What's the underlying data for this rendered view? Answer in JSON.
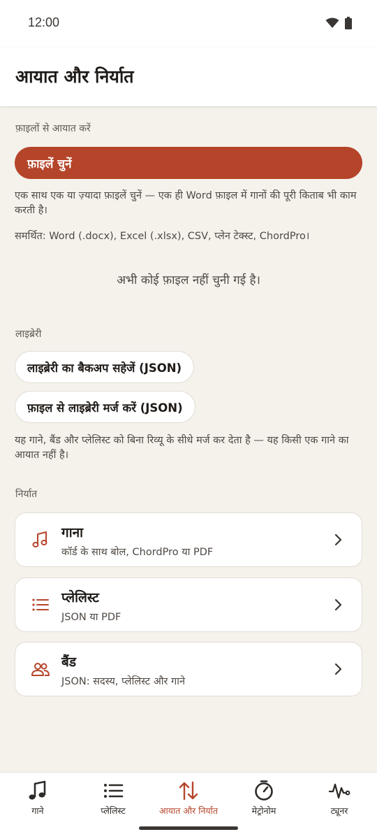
{
  "status_bar": {
    "time": "12:00"
  },
  "header": {
    "title": "आयात और निर्यात"
  },
  "import": {
    "section_label": "फ़ाइलों से आयात करें",
    "choose_files_label": "फ़ाइलें चुनें",
    "help_text": "एक साथ एक या ज़्यादा फ़ाइलें चुनें — एक ही Word फ़ाइल में गानों की पूरी किताब भी काम करती है।",
    "supported_text": "समर्थित: Word (.docx), Excel (.xlsx), CSV, प्लेन टेक्स्ट, ChordPro।",
    "empty_state": "अभी कोई फ़ाइल नहीं चुनी गई है।"
  },
  "library": {
    "section_label": "लाइब्रेरी",
    "backup_label": "लाइब्रेरी का बैकअप सहेजें (JSON)",
    "merge_label": "फ़ाइल से लाइब्रेरी मर्ज करें (JSON)",
    "help_text": "यह गाने, बैंड और प्लेलिस्ट को बिना रिव्यू के सीधे मर्ज कर देता है — यह किसी एक गाने का आयात नहीं है।"
  },
  "export": {
    "section_label": "निर्यात",
    "items": [
      {
        "title": "गाना",
        "subtitle": "कॉर्ड के साथ बोल, ChordPro या PDF",
        "icon": "music-note-icon"
      },
      {
        "title": "प्लेलिस्ट",
        "subtitle": "JSON या PDF",
        "icon": "list-icon"
      },
      {
        "title": "बैंड",
        "subtitle": "JSON: सदस्य, प्लेलिस्ट और गाने",
        "icon": "people-icon"
      }
    ]
  },
  "bottom_nav": {
    "items": [
      {
        "label": "गाने",
        "icon": "music-note-icon"
      },
      {
        "label": "प्लेलिस्ट",
        "icon": "list-icon"
      },
      {
        "label": "आयात और निर्यात",
        "icon": "import-export-icon",
        "active": true
      },
      {
        "label": "मेट्रोनोम",
        "icon": "metronome-icon"
      },
      {
        "label": "ट्यूनर",
        "icon": "tuner-icon"
      }
    ]
  },
  "colors": {
    "accent": "#B5452A",
    "background": "#F5F2EC",
    "surface": "#FFFFFF"
  }
}
